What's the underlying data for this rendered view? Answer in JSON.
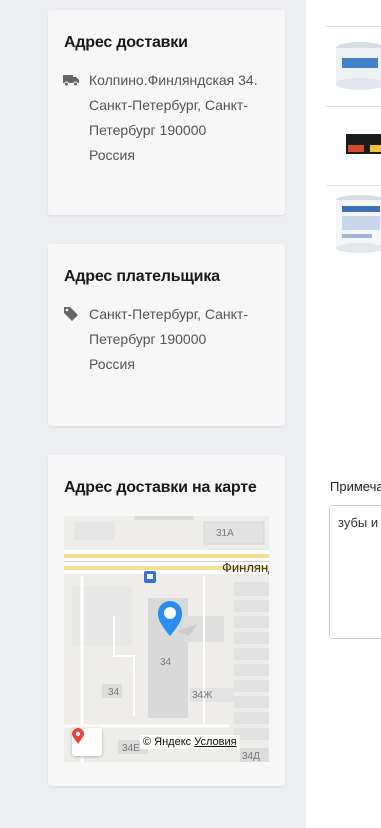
{
  "delivery": {
    "title": "Адрес доставки",
    "icon": "truck-icon",
    "lines": [
      "Колпино.Финляндская 34.",
      "Санкт-Петербург, Санкт-",
      "Петербург 190000",
      "Россия"
    ]
  },
  "payer": {
    "title": "Адрес плательщика",
    "icon": "tag-icon",
    "lines": [
      "Санкт-Петербург, Санкт-",
      "Петербург 190000",
      "Россия"
    ]
  },
  "map": {
    "title": "Адрес доставки на карте",
    "street": "Финлянд",
    "labels": [
      "31А",
      "34",
      "34",
      "34Ж",
      "34Е",
      "34Д"
    ],
    "attribution": "© Яндекс",
    "terms": "Условия"
  },
  "right": {
    "note_label": "Примеча",
    "note_value": "зубы и"
  }
}
